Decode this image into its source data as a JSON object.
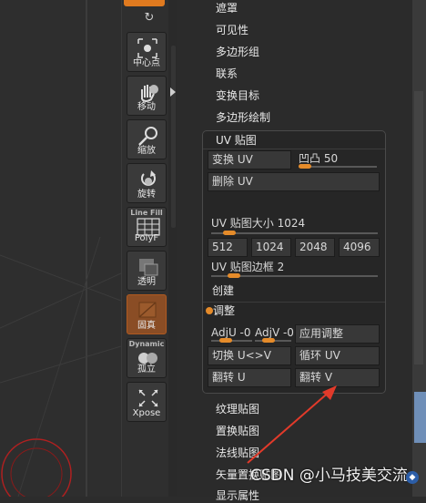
{
  "shelf": {
    "tools": [
      {
        "label": "中心点",
        "top_label": ""
      },
      {
        "label": "移动",
        "top_label": ""
      },
      {
        "label": "缩放",
        "top_label": ""
      },
      {
        "label": "旋转",
        "top_label": ""
      },
      {
        "label": "PolyF",
        "top_label": "Line Fill"
      },
      {
        "label": "透明",
        "top_label": ""
      },
      {
        "label": "固真",
        "top_label": ""
      },
      {
        "label": "孤立",
        "top_label": "Dynamic"
      },
      {
        "label": "Xpose",
        "top_label": ""
      }
    ],
    "active_tool": "固真"
  },
  "menu": {
    "items_top": [
      "遮罩",
      "可见性",
      "多边形组",
      "联系",
      "变换目标",
      "多边形绘制"
    ],
    "items_bottom": [
      "纹理贴图",
      "置换贴图",
      "法线贴图",
      "矢量置换贴图",
      "显示属性"
    ]
  },
  "uv_panel": {
    "title": "UV 贴图",
    "morph_uv": "变换 UV",
    "bump_label": "凹凸 50",
    "bump_value": 50,
    "delete_uv": "删除 UV",
    "uv_map_size_label": "UV 贴图大小 1024",
    "uv_map_size_value": 1024,
    "size_options": [
      "512",
      "1024",
      "2048",
      "4096"
    ],
    "uv_border_label": "UV 贴图边框 2",
    "uv_border_value": 2,
    "create": "创建",
    "adjust_title": "调整",
    "adj_u": "AdjU -0",
    "adj_v": "AdjV -0.",
    "apply_adjust": "应用调整",
    "switch_uv": "切换 U<>V",
    "cycle_uv": "循环 UV",
    "flip_u": "翻转 U",
    "flip_v": "翻转 V"
  },
  "watermark": "CSDN @小马技美交流",
  "colors": {
    "accent": "#e58b2a",
    "active_tool": "#8a4d25",
    "annotation_arrow": "#e23a2a"
  },
  "icons": [
    "center-icon",
    "move-hand-icon",
    "scale-icon",
    "rotate-icon",
    "polyframe-grid-icon",
    "transparency-icon",
    "ghost-icon",
    "dynamic-spheres-icon",
    "xpose-icon",
    "rotate-small-icon"
  ]
}
